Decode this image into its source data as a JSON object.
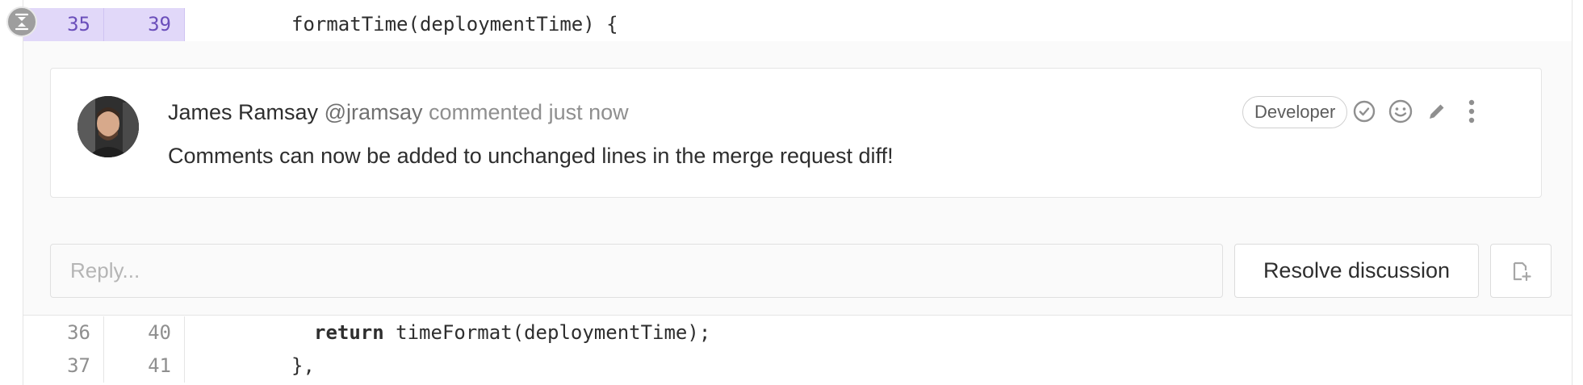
{
  "diff": {
    "lines": [
      {
        "old": "35",
        "new": "39",
        "code": "formatTime(deploymentTime) {",
        "keyword": ""
      },
      {
        "old": "36",
        "new": "40",
        "code": " timeFormat(deploymentTime);",
        "keyword": "return"
      },
      {
        "old": "37",
        "new": "41",
        "code": "},",
        "keyword": ""
      }
    ]
  },
  "note": {
    "author_name": "James Ramsay",
    "author_username": "@jramsay",
    "meta": "commented just now",
    "role_badge": "Developer",
    "body": "Comments can now be added to unchanged lines in the merge request diff!"
  },
  "reply": {
    "placeholder": "Reply...",
    "resolve_label": "Resolve discussion"
  },
  "colors": {
    "highlight_line_bg": "#e1d8f9",
    "highlight_line_fg": "#6b4fbb"
  },
  "icons": [
    "collapse-icon",
    "resolve-check-icon",
    "emoji-smiley-icon",
    "edit-pencil-icon",
    "more-actions-icon",
    "new-issue-icon"
  ]
}
